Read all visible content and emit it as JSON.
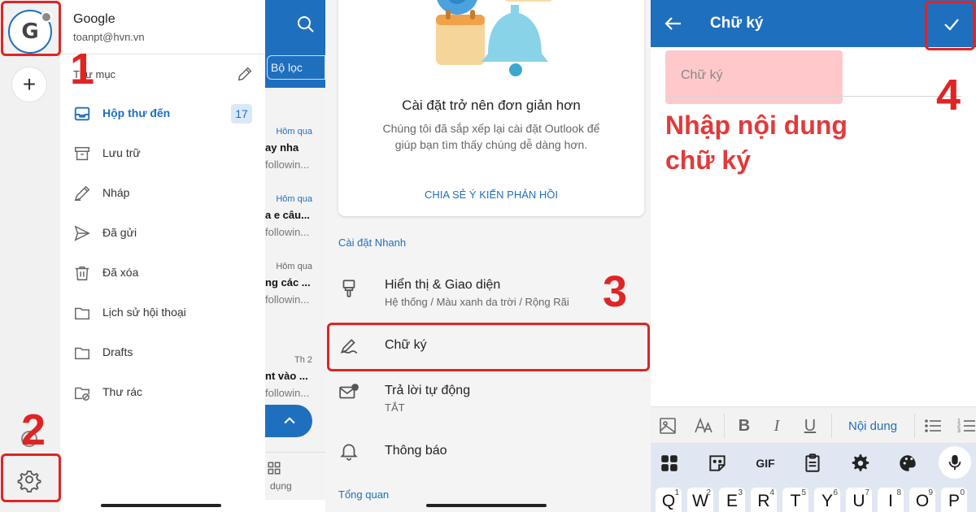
{
  "panel1": {
    "background": {
      "filter_chip": "Bộ lọc",
      "messages": [
        {
          "date": "Hôm qua",
          "subject": "ay nha",
          "preview": "followin..."
        },
        {
          "date": "Hôm qua",
          "subject": "a e câu...",
          "preview": "followin..."
        },
        {
          "date": "Hôm qua",
          "subject": "ng các ...",
          "preview": "followin..."
        },
        {
          "date": "Th 2",
          "subject": "nt vào ...",
          "preview": "followin..."
        }
      ],
      "bottom_nav_label": "dụng"
    },
    "account": {
      "avatar_letter": "G",
      "name": "Google",
      "email": "toanpt@hvn.vn"
    },
    "folders_label": "Thư mục",
    "folders": [
      {
        "label": "Hộp thư đến",
        "icon": "inbox-icon",
        "count": "17",
        "active": true
      },
      {
        "label": "Lưu trữ",
        "icon": "archive-icon"
      },
      {
        "label": "Nháp",
        "icon": "draft-pencil-icon"
      },
      {
        "label": "Đã gửi",
        "icon": "send-icon"
      },
      {
        "label": "Đã xóa",
        "icon": "trash-icon"
      },
      {
        "label": "Lịch sử hội thoại",
        "icon": "folder-icon"
      },
      {
        "label": "Drafts",
        "icon": "folder-icon"
      },
      {
        "label": "Thư rác",
        "icon": "junk-folder-icon"
      }
    ],
    "add_label": "+"
  },
  "panel2": {
    "card": {
      "title": "Cài đặt trở nên đơn giản hơn",
      "body": "Chúng tôi đã sắp xếp lại cài đặt Outlook để giúp bạn tìm thấy chúng dễ dàng hơn.",
      "link": "CHIA SẺ Ý KIẾN PHẢN HỒI"
    },
    "quick_settings_label": "Cài đặt Nhanh",
    "settings": [
      {
        "title": "Hiển thị & Giao diện",
        "subtitle": "Hệ thống / Màu xanh da trời / Rộng Rãi",
        "icon": "paint-brush-icon"
      },
      {
        "title": "Chữ ký",
        "subtitle": "",
        "icon": "signature-pen-icon"
      },
      {
        "title": "Trả lời tự động",
        "subtitle": "TẮT",
        "icon": "auto-reply-icon"
      },
      {
        "title": "Thông báo",
        "subtitle": "",
        "icon": "bell-icon"
      }
    ],
    "overview_label": "Tổng quan"
  },
  "panel3": {
    "title": "Chữ ký",
    "signature_placeholder": "Chữ ký",
    "instruction_line1": "Nhập nội dung",
    "instruction_line2": "chữ ký",
    "format_style": "Nội dung",
    "format_bold": "B",
    "format_italic": "I",
    "format_underline": "U",
    "keyboard_gif": "GIF",
    "keys": [
      {
        "letter": "Q",
        "number": "1"
      },
      {
        "letter": "W",
        "number": "2"
      },
      {
        "letter": "E",
        "number": "3"
      },
      {
        "letter": "R",
        "number": "4"
      },
      {
        "letter": "T",
        "number": "5"
      },
      {
        "letter": "Y",
        "number": "6"
      },
      {
        "letter": "U",
        "number": "7"
      },
      {
        "letter": "I",
        "number": "8"
      },
      {
        "letter": "O",
        "number": "9"
      },
      {
        "letter": "P",
        "number": "0"
      }
    ]
  },
  "steps": {
    "s1": "1",
    "s2": "2",
    "s3": "3",
    "s4": "4"
  },
  "colors": {
    "accent": "#1f6fbf",
    "annotation": "#e02424",
    "signature_highlight": "#ffc9cc"
  }
}
